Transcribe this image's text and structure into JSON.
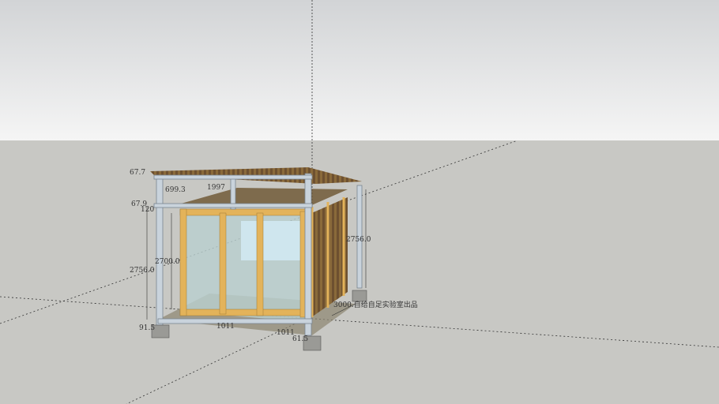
{
  "scene": {
    "sky_color_top": "#d4d6d8",
    "sky_color_bottom": "#f4f4f4",
    "ground_color": "#c8c8c4",
    "dimensions": {
      "roof_thickness": "67.7",
      "eave_offset": "699.3",
      "top_span": "1997",
      "beam_height": "67.9",
      "beam_small": "120",
      "wall_height": "2700.0",
      "left_height": "2756.0",
      "right_height": "2756.0",
      "depth_label": "3000.自给自足实验室出品",
      "foot_left": "91.5",
      "bottom_span_1": "1011",
      "bottom_span_2": "1011",
      "foot_right": "61.5"
    }
  }
}
